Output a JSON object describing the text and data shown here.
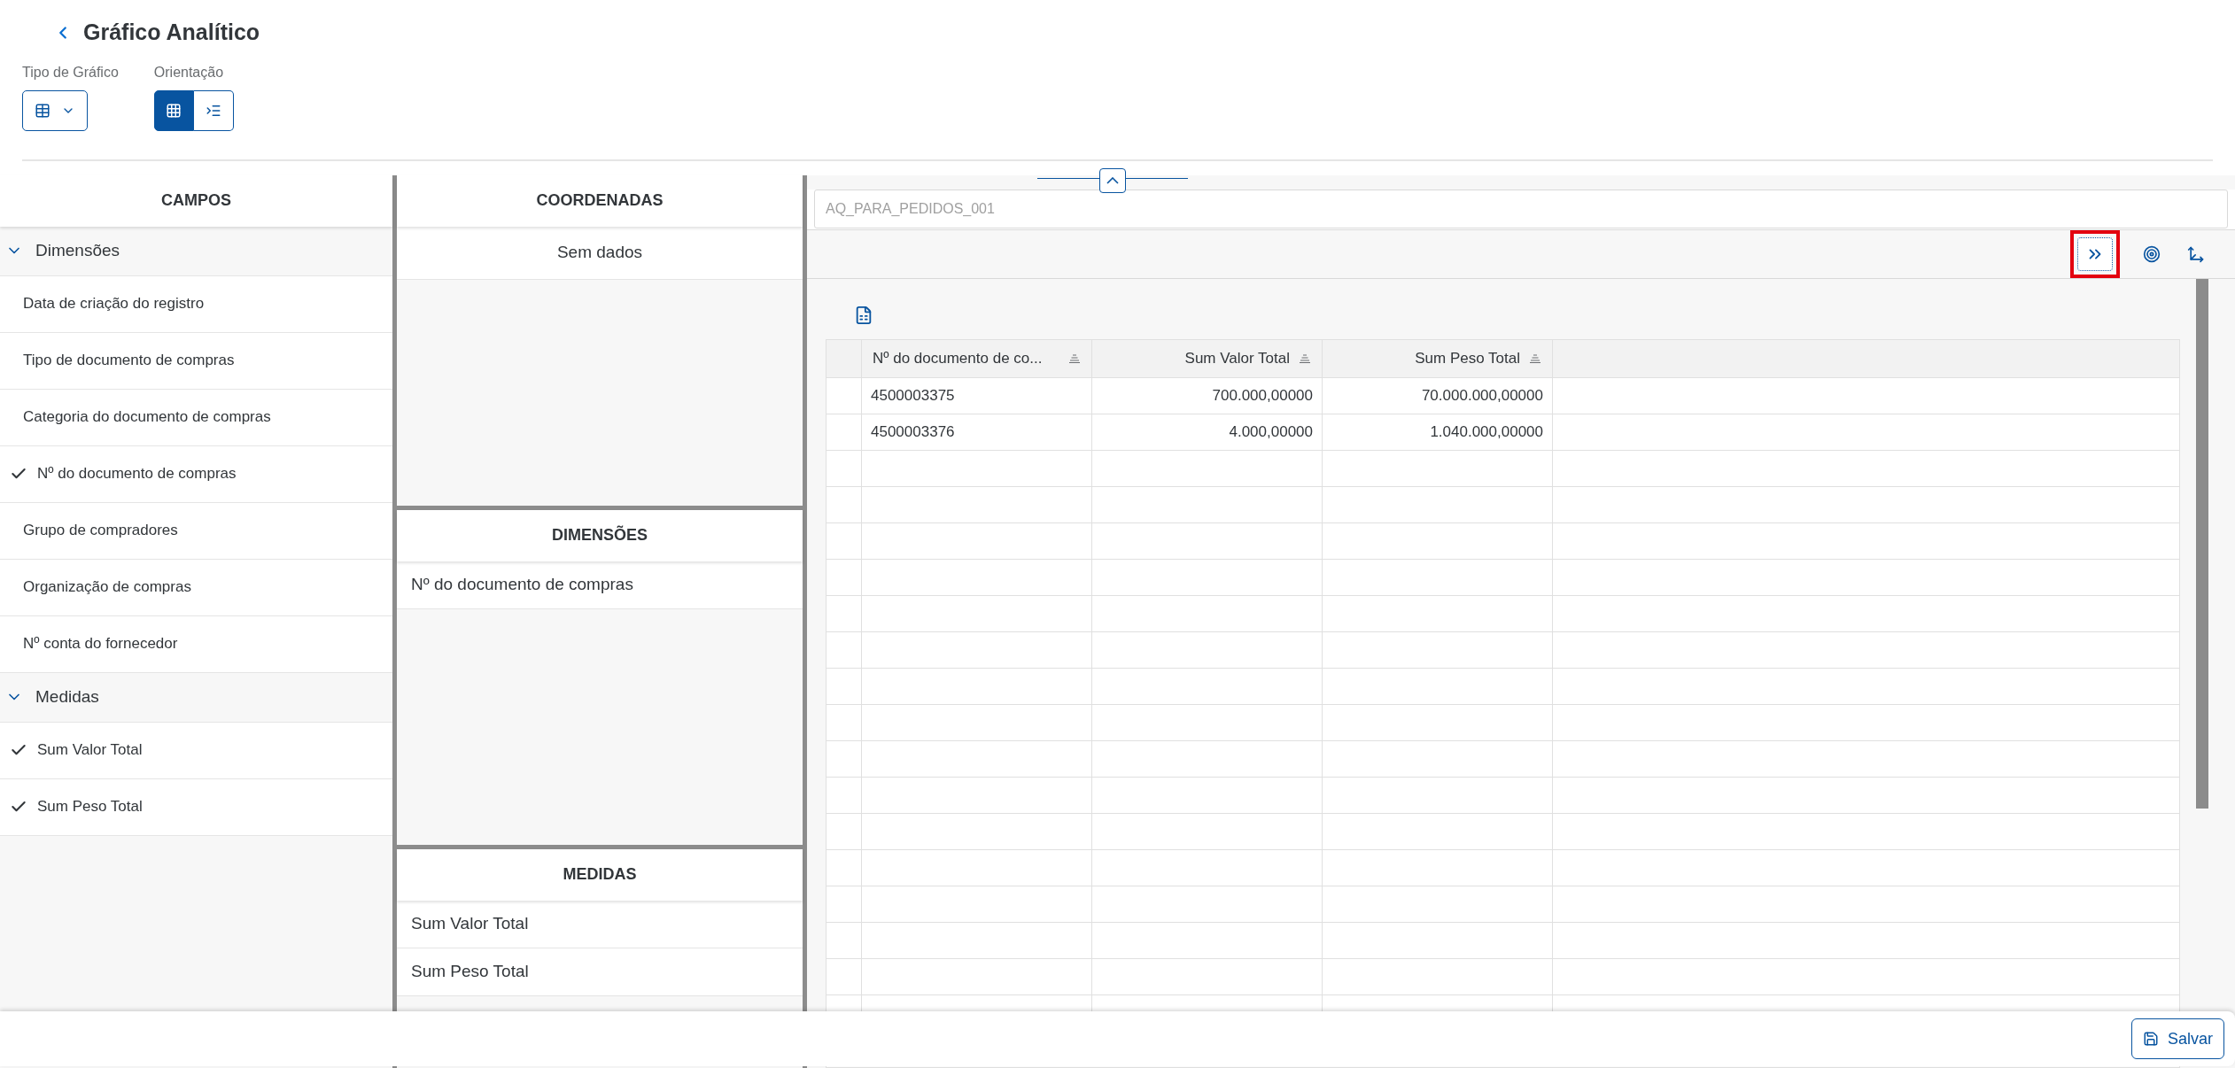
{
  "header": {
    "title": "Gráfico Analítico"
  },
  "chart_type": {
    "label": "Tipo de Gráfico"
  },
  "orientation": {
    "label": "Orientação",
    "options": [
      {
        "kind": "grid",
        "selected": true
      },
      {
        "kind": "indent",
        "selected": false
      }
    ]
  },
  "fields": {
    "title": "CAMPOS",
    "groups": [
      {
        "label": "Dimensões",
        "expanded": true,
        "items": [
          {
            "label": "Data de criação do registro",
            "checked": false
          },
          {
            "label": "Tipo de documento de compras",
            "checked": false
          },
          {
            "label": "Categoria do documento de compras",
            "checked": false
          },
          {
            "label": "Nº do documento de compras",
            "checked": true
          },
          {
            "label": "Grupo de compradores",
            "checked": false
          },
          {
            "label": "Organização de compras",
            "checked": false
          },
          {
            "label": "Nº conta do fornecedor",
            "checked": false
          }
        ]
      },
      {
        "label": "Medidas",
        "expanded": true,
        "items": [
          {
            "label": "Sum Valor Total",
            "checked": true
          },
          {
            "label": "Sum Peso Total",
            "checked": true
          }
        ]
      }
    ]
  },
  "coordinates": {
    "title": "COORDENADAS",
    "items": [
      "Sem dados"
    ]
  },
  "dimensions": {
    "title": "DIMENSÕES",
    "items": [
      "Nº do documento de compras"
    ]
  },
  "measures": {
    "title": "MEDIDAS",
    "items": [
      "Sum Valor Total",
      "Sum Peso Total"
    ]
  },
  "query": {
    "value": "AQ_PARA_PEDIDOS_001"
  },
  "table": {
    "columns": [
      {
        "label": "Nº do documento de co...",
        "kind": "text"
      },
      {
        "label": "Sum Valor Total",
        "kind": "number"
      },
      {
        "label": "Sum Peso Total",
        "kind": "number"
      }
    ],
    "rows": [
      [
        "4500003375",
        "700.000,00000",
        "70.000.000,00000"
      ],
      [
        "4500003376",
        "4.000,00000",
        "1.040.000,00000"
      ]
    ]
  },
  "footer": {
    "save": "Salvar"
  }
}
